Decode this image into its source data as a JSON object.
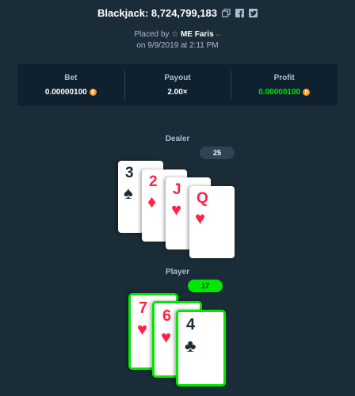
{
  "header": {
    "game_name": "Blackjack",
    "bet_id": "8,724,799,183",
    "title": "Blackjack: 8,724,799,183",
    "copy_icon": "copy-icon",
    "facebook_icon": "facebook-icon",
    "twitter_icon": "twitter-icon"
  },
  "placed": {
    "prefix": "Placed by",
    "username": "ME Faris",
    "date": "on 9/9/2019 at 2:11 PM"
  },
  "stats": {
    "bet_label": "Bet",
    "bet_value": "0.00000100",
    "payout_label": "Payout",
    "payout_value": "2.00×",
    "profit_label": "Profit",
    "profit_value": "0.00000100",
    "currency_symbol": "₿"
  },
  "dealer": {
    "label": "Dealer",
    "score": "25",
    "cards": [
      {
        "rank": "3",
        "suit": "♠",
        "color": "#1a2c38"
      },
      {
        "rank": "2",
        "suit": "♦",
        "color": "#fe2247"
      },
      {
        "rank": "J",
        "suit": "♥",
        "color": "#fe2247"
      },
      {
        "rank": "Q",
        "suit": "♥",
        "color": "#fe2247"
      }
    ]
  },
  "player": {
    "label": "Player",
    "score": "17",
    "cards": [
      {
        "rank": "7",
        "suit": "♥",
        "color": "#fe2247"
      },
      {
        "rank": "6",
        "suit": "♥",
        "color": "#fe2247"
      },
      {
        "rank": "4",
        "suit": "♣",
        "color": "#1a2c38"
      }
    ]
  },
  "colors": {
    "background": "#1a2c38",
    "panel": "#0f212e",
    "win_green": "#00e701",
    "red_suit": "#fe2247",
    "muted_text": "#b1bad3"
  }
}
